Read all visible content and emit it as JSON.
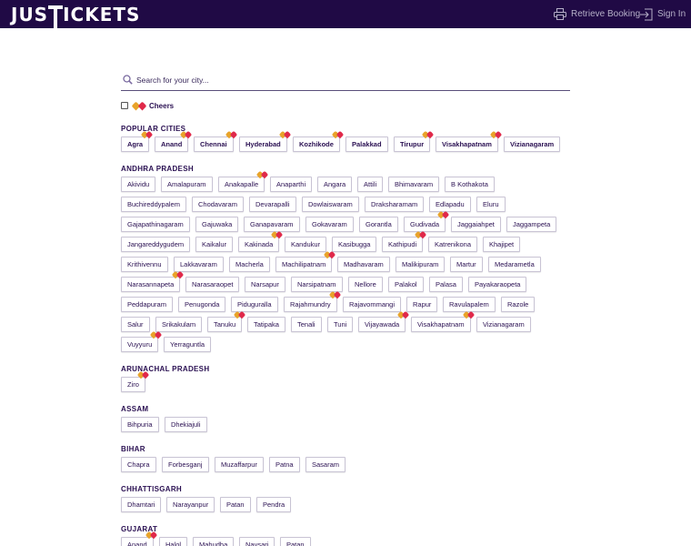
{
  "header": {
    "logo_left": "JUS",
    "logo_right": "ICKETS",
    "retrieve_label": "Retrieve Booking",
    "signin_label": "Sign In"
  },
  "search": {
    "placeholder": "Search for your city..."
  },
  "cheers": {
    "label": "Cheers",
    "checked": false
  },
  "colors": {
    "header_bg": "#200a45",
    "accent": "#2a1052",
    "heart_gold": "#e8a32a",
    "heart_red": "#e0294a"
  },
  "sections": [
    {
      "title": "POPULAR CITIES",
      "popular": true,
      "rows": [
        [
          {
            "name": "Agra",
            "heart": true
          },
          {
            "name": "Anand",
            "heart": true
          },
          {
            "name": "Chennai",
            "heart": true
          },
          {
            "name": "Hyderabad",
            "heart": true
          },
          {
            "name": "Kozhikode",
            "heart": true
          },
          {
            "name": "Palakkad",
            "heart": false
          },
          {
            "name": "Tirupur",
            "heart": true
          },
          {
            "name": "Visakhapatnam",
            "heart": true
          },
          {
            "name": "Vizianagaram",
            "heart": false
          }
        ]
      ]
    },
    {
      "title": "ANDHRA PRADESH",
      "rows": [
        [
          {
            "name": "Akividu"
          },
          {
            "name": "Amalapuram"
          },
          {
            "name": "Anakapalle",
            "heart": true
          },
          {
            "name": "Anaparthi"
          },
          {
            "name": "Angara"
          },
          {
            "name": "Attili"
          },
          {
            "name": "Bhimavaram"
          },
          {
            "name": "B Kothakota"
          }
        ],
        [
          {
            "name": "Buchireddypalem"
          },
          {
            "name": "Chodavaram"
          },
          {
            "name": "Devarapalli"
          },
          {
            "name": "Dowlaiswaram"
          },
          {
            "name": "Draksharamam"
          },
          {
            "name": "Edlapadu"
          },
          {
            "name": "Eluru"
          }
        ],
        [
          {
            "name": "Gajapathinagaram"
          },
          {
            "name": "Gajuwaka"
          },
          {
            "name": "Ganapavaram"
          },
          {
            "name": "Gokavaram"
          },
          {
            "name": "Gorantla"
          },
          {
            "name": "Gudivada",
            "heart": true
          },
          {
            "name": "Jaggaiahpet"
          },
          {
            "name": "Jaggampeta"
          }
        ],
        [
          {
            "name": "Jangareddygudem"
          },
          {
            "name": "Kaikalur"
          },
          {
            "name": "Kakinada",
            "heart": true
          },
          {
            "name": "Kandukur"
          },
          {
            "name": "Kasibugga"
          },
          {
            "name": "Kathipudi",
            "heart": true
          },
          {
            "name": "Katrenikona"
          },
          {
            "name": "Khajipet"
          }
        ],
        [
          {
            "name": "Krithivennu"
          },
          {
            "name": "Lakkavaram"
          },
          {
            "name": "Macherla"
          },
          {
            "name": "Machilipatnam",
            "heart": true
          },
          {
            "name": "Madhavaram"
          },
          {
            "name": "Malikipuram"
          },
          {
            "name": "Martur"
          },
          {
            "name": "Medarametla"
          }
        ],
        [
          {
            "name": "Narasannapeta",
            "heart": true
          },
          {
            "name": "Narasaraopet"
          },
          {
            "name": "Narsapur"
          },
          {
            "name": "Narsipatnam"
          },
          {
            "name": "Nellore"
          },
          {
            "name": "Palakol"
          },
          {
            "name": "Palasa"
          },
          {
            "name": "Payakaraopeta"
          }
        ],
        [
          {
            "name": "Peddapuram"
          },
          {
            "name": "Penugonda"
          },
          {
            "name": "Piduguralla"
          },
          {
            "name": "Rajahmundry",
            "heart": true
          },
          {
            "name": "Rajavommangi"
          },
          {
            "name": "Rapur"
          },
          {
            "name": "Ravulapalem"
          },
          {
            "name": "Razole"
          }
        ],
        [
          {
            "name": "Salur"
          },
          {
            "name": "Srikakulam"
          },
          {
            "name": "Tanuku",
            "heart": true
          },
          {
            "name": "Tatipaka"
          },
          {
            "name": "Tenali"
          },
          {
            "name": "Tuni"
          },
          {
            "name": "Vijayawada",
            "heart": true
          },
          {
            "name": "Visakhapatnam",
            "heart": true
          },
          {
            "name": "Vizianagaram"
          }
        ],
        [
          {
            "name": "Vuyyuru",
            "heart": true
          },
          {
            "name": "Yerraguntla"
          }
        ]
      ]
    },
    {
      "title": "ARUNACHAL PRADESH",
      "rows": [
        [
          {
            "name": "Ziro",
            "heart": true
          }
        ]
      ]
    },
    {
      "title": "ASSAM",
      "rows": [
        [
          {
            "name": "Bihpuria"
          },
          {
            "name": "Dhekiajuli"
          }
        ]
      ]
    },
    {
      "title": "BIHAR",
      "rows": [
        [
          {
            "name": "Chapra"
          },
          {
            "name": "Forbesganj"
          },
          {
            "name": "Muzaffarpur"
          },
          {
            "name": "Patna"
          },
          {
            "name": "Sasaram"
          }
        ]
      ]
    },
    {
      "title": "CHHATTISGARH",
      "rows": [
        [
          {
            "name": "Dhamtari"
          },
          {
            "name": "Narayanpur"
          },
          {
            "name": "Patan"
          },
          {
            "name": "Pendra"
          }
        ]
      ]
    },
    {
      "title": "GUJARAT",
      "rows": [
        [
          {
            "name": "Anand",
            "heart": true
          },
          {
            "name": "Halol"
          },
          {
            "name": "Mahudha"
          },
          {
            "name": "Navsari"
          },
          {
            "name": "Patan"
          }
        ]
      ]
    }
  ]
}
